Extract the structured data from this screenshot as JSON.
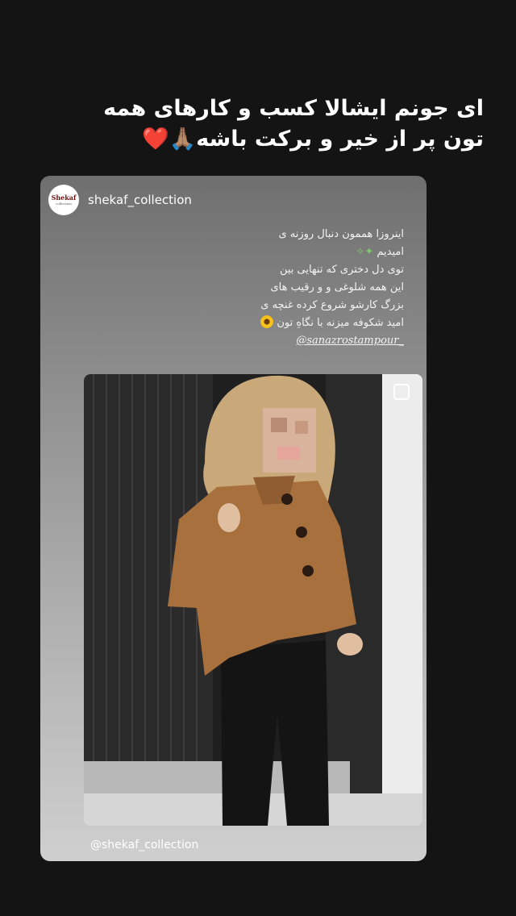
{
  "story": {
    "caption_line1": "ای جونم ایشالا کسب و کارهای همه",
    "caption_line2": "تون پر از خیر و برکت باشه🙏🏽❤️"
  },
  "post": {
    "username": "shekaf_collection",
    "avatar_brand": "Shekaf",
    "avatar_sub": "collection",
    "text_line1": "اینروزا هممون دنبال روزنه ی",
    "text_line2": "امیدیم",
    "text_line3": "توی دل دختری که تنهایی بین",
    "text_line4": "این همه شلوغی و و رقیب های",
    "text_line5": "بزرگ کارشو شروع کرده غنچه ی",
    "text_line6": "امید شکوفه میزنه با نگاهِ تون",
    "mention": "@sanazrostampour_",
    "footer_username": "@shekaf_collection"
  },
  "icons": {
    "sparkle": "sparkle-icon",
    "sunflower": "sunflower-icon",
    "select": "checkbox-icon"
  }
}
